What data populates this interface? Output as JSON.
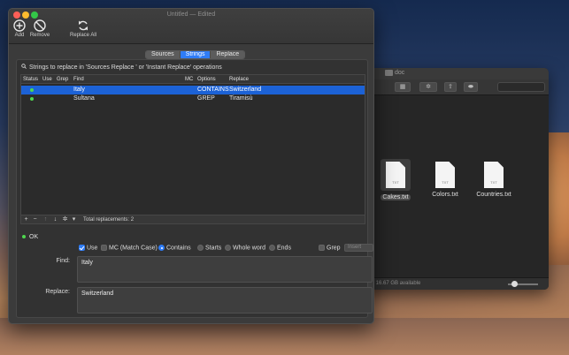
{
  "main_window": {
    "title": "Untitled — Edited",
    "toolbar": {
      "add_label": "Add",
      "remove_label": "Remove",
      "replace_all_label": "Replace All"
    },
    "tabs": [
      {
        "label": "Sources",
        "active": false
      },
      {
        "label": "Strings",
        "active": true
      },
      {
        "label": "Replace",
        "active": false
      }
    ],
    "description": "Strings to replace in  'Sources Replace ' or  'Instant Replace' operations",
    "table": {
      "columns": [
        "Status",
        "Use",
        "Grep",
        "Find",
        "MC",
        "Options",
        "Replace"
      ],
      "rows": [
        {
          "status": "green",
          "find": "Italy",
          "options": "CONTAINS",
          "replace": "Switzerland",
          "selected": true
        },
        {
          "status": "green",
          "find": "Sultana",
          "options": "GREP",
          "replace": "Tiramisù",
          "selected": false
        }
      ],
      "footer": {
        "buttons": [
          "+",
          "−",
          "↑",
          "↓",
          "gear",
          "▾"
        ],
        "total": "Total replacements: 2"
      }
    },
    "status_text": "OK",
    "options": {
      "use_label": "Use",
      "use_checked": true,
      "mc_label": "MC (Match Case)",
      "mc_checked": false,
      "contains_label": "Contains",
      "starts_label": "Starts",
      "whole_word_label": "Whole word",
      "ends_label": "Ends",
      "selected_mode": "Contains",
      "grep_label": "Grep",
      "grep_checked": false,
      "insert_label": "Insert"
    },
    "find_label": "Find:",
    "find_value": "Italy",
    "replace_label": "Replace:",
    "replace_value": "Switzerland"
  },
  "finder_window": {
    "title": "doc",
    "files": [
      {
        "name": "Cakes.txt",
        "badge": "TXT",
        "selected": true
      },
      {
        "name": "Colors.txt",
        "badge": "TXT",
        "selected": false
      },
      {
        "name": "Countries.txt",
        "badge": "TXT",
        "selected": false
      }
    ],
    "status": "cted, 16.67 GB available"
  },
  "colors": {
    "accent": "#2f7cf6",
    "selection": "#1c62d6",
    "status_ok": "#4fd84f",
    "window_bg": "#3b3b3b"
  }
}
